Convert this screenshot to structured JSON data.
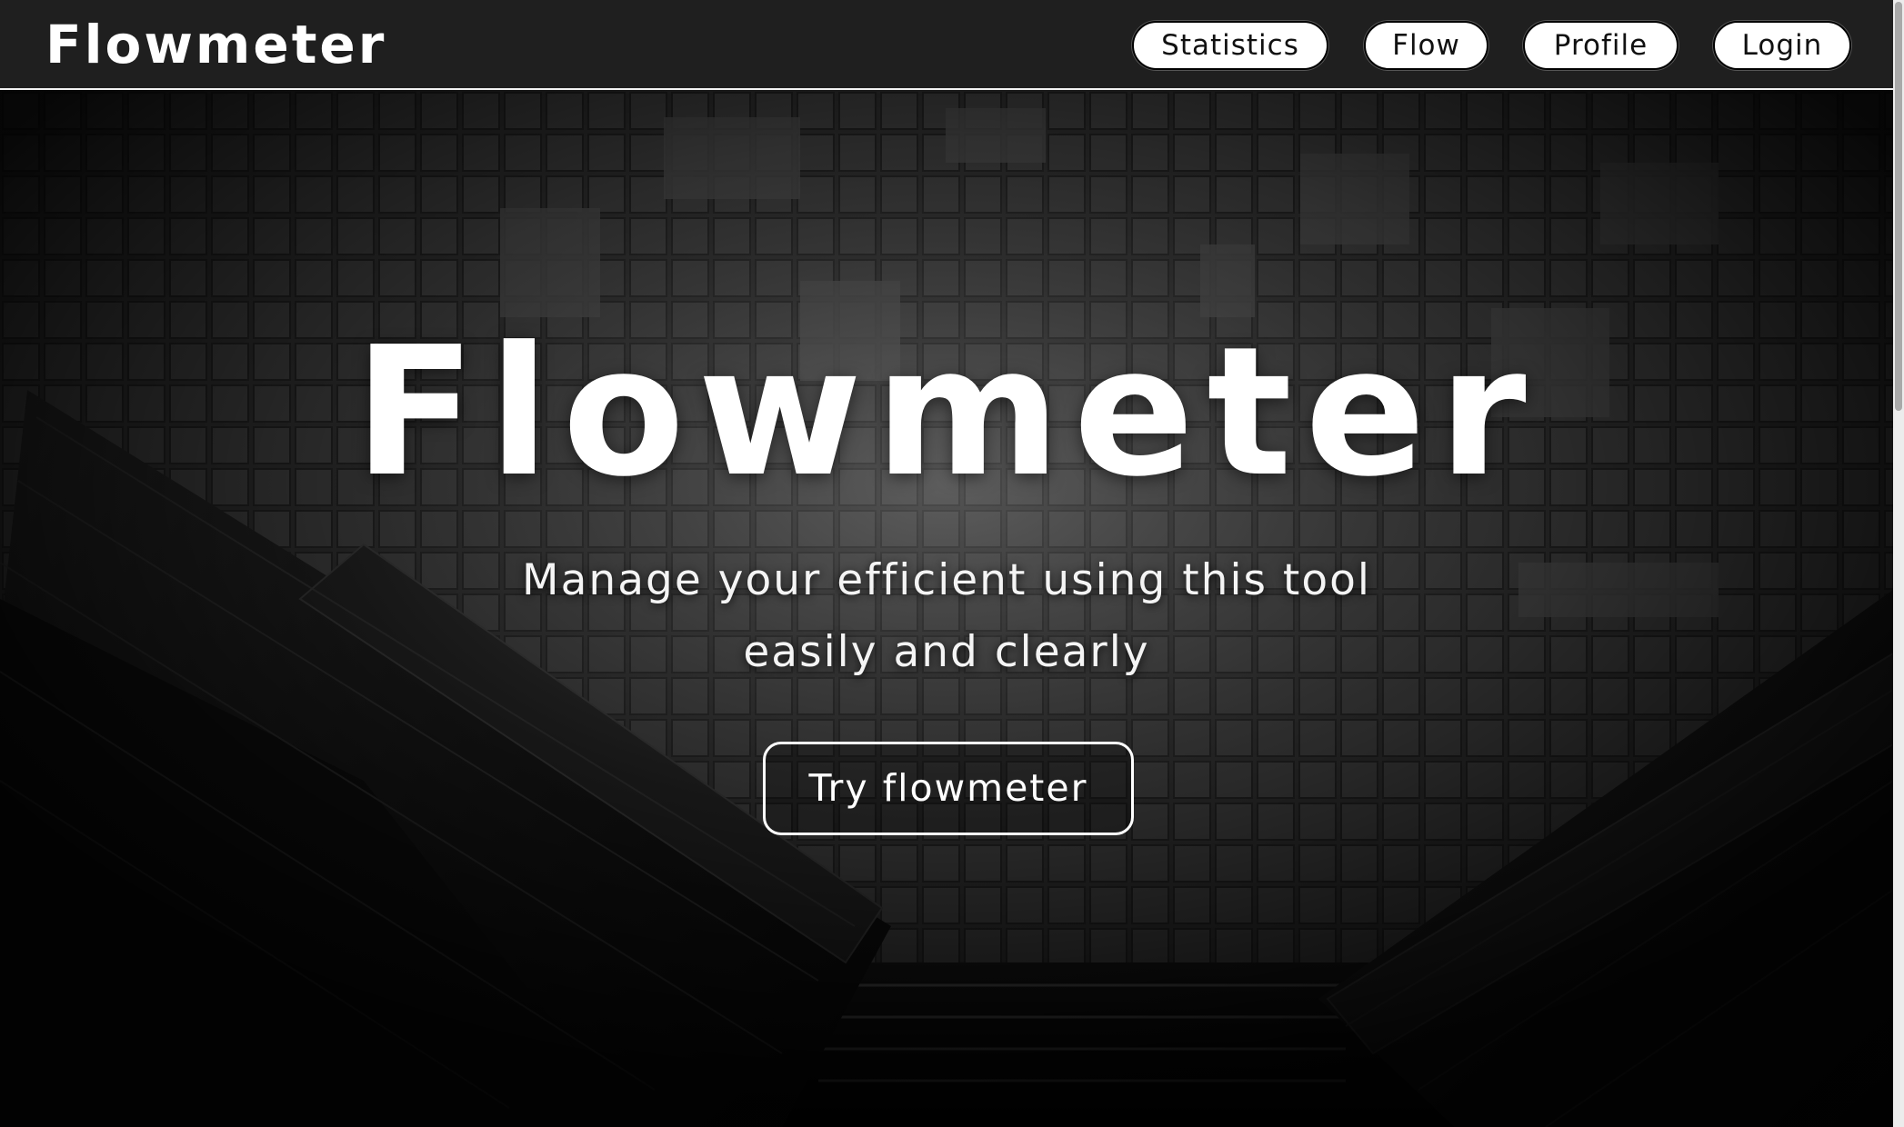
{
  "header": {
    "logo": "Flowmeter",
    "nav": [
      {
        "label": "Statistics"
      },
      {
        "label": "Flow"
      },
      {
        "label": "Profile"
      },
      {
        "label": "Login"
      }
    ]
  },
  "hero": {
    "title": "Flowmeter",
    "subtitle_line1": "Manage your efficient using this tool",
    "subtitle_line2": "easily and clearly",
    "cta_label": "Try flowmeter"
  },
  "colors": {
    "header_bg": "#1f1f1f",
    "nav_button_bg": "#ffffff",
    "hero_text": "#ffffff",
    "hero_bg": "#0b0b0b"
  }
}
